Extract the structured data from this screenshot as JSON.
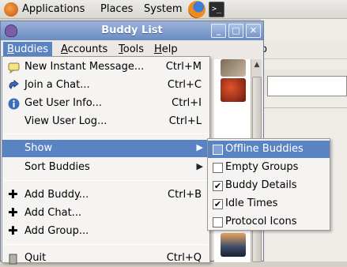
{
  "panel": {
    "applications": "Applications",
    "places": "Places",
    "system": "System"
  },
  "bg_window": {
    "menu_fragment": "o"
  },
  "buddy_list": {
    "title": "Buddy List",
    "menubar": [
      "Buddies",
      "Accounts",
      "Tools",
      "Help"
    ]
  },
  "buddies_menu": {
    "items": [
      {
        "label": "New Instant Message...",
        "accel": "Ctrl+M",
        "icon": "message-icon"
      },
      {
        "label": "Join a Chat...",
        "accel": "Ctrl+C",
        "icon": "chat-icon"
      },
      {
        "label": "Get User Info...",
        "accel": "Ctrl+I",
        "icon": "info-icon"
      },
      {
        "label": "View User Log...",
        "accel": "Ctrl+L",
        "icon": ""
      },
      {
        "label": "Show",
        "accel": "",
        "icon": ""
      },
      {
        "label": "Sort Buddies",
        "accel": "",
        "icon": ""
      },
      {
        "label": "Add Buddy...",
        "accel": "Ctrl+B",
        "icon": "plus-icon"
      },
      {
        "label": "Add Chat...",
        "accel": "",
        "icon": "plus-icon"
      },
      {
        "label": "Add Group...",
        "accel": "",
        "icon": "plus-icon"
      },
      {
        "label": "Quit",
        "accel": "Ctrl+Q",
        "icon": "quit-icon"
      }
    ]
  },
  "show_submenu": {
    "items": [
      {
        "label": "Offline Buddies",
        "checked": false
      },
      {
        "label": "Empty Groups",
        "checked": false
      },
      {
        "label": "Buddy Details",
        "checked": true
      },
      {
        "label": "Idle Times",
        "checked": true
      },
      {
        "label": "Protocol Icons",
        "checked": false
      }
    ]
  },
  "colors": {
    "highlight": "#5a83c4",
    "titlebar": "#6b8cc2"
  }
}
